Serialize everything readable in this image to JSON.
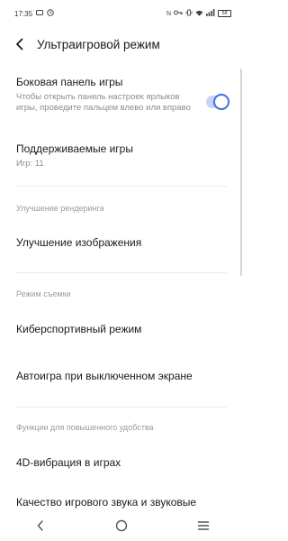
{
  "status_bar": {
    "time": "17:35",
    "left_icons": [
      "message-icon",
      "clock-icon"
    ],
    "right_icons": [
      "nfc-icon",
      "key-icon",
      "vibrate-icon",
      "wifi-icon",
      "signal-icon"
    ],
    "battery": "58"
  },
  "header": {
    "title": "Ультраигровой режим"
  },
  "settings": {
    "side_panel": {
      "title": "Боковая панель игры",
      "subtitle": "Чтобы открыть панель настроек ярлыков игры, проведите пальцем влево или вправо",
      "toggle_on": true
    },
    "supported_games": {
      "title": "Поддерживаемые игры",
      "subtitle": "Игр: 11"
    },
    "section_render": "Улучшение рендеринга",
    "image_enhance": "Улучшение изображения",
    "section_shooting": "Режим съемки",
    "esports_mode": "Киберспортивный режим",
    "autoplay_screen_off": "Автоигра при выключенном экране",
    "section_convenience": "Функции для повышенного удобства",
    "vibration_4d": "4D-вибрация в играх",
    "game_sound": "Качество игрового звука и звуковые эффекты"
  },
  "colors": {
    "accent": "#3e6ee8",
    "toggle_track": "#c6d3f6"
  }
}
